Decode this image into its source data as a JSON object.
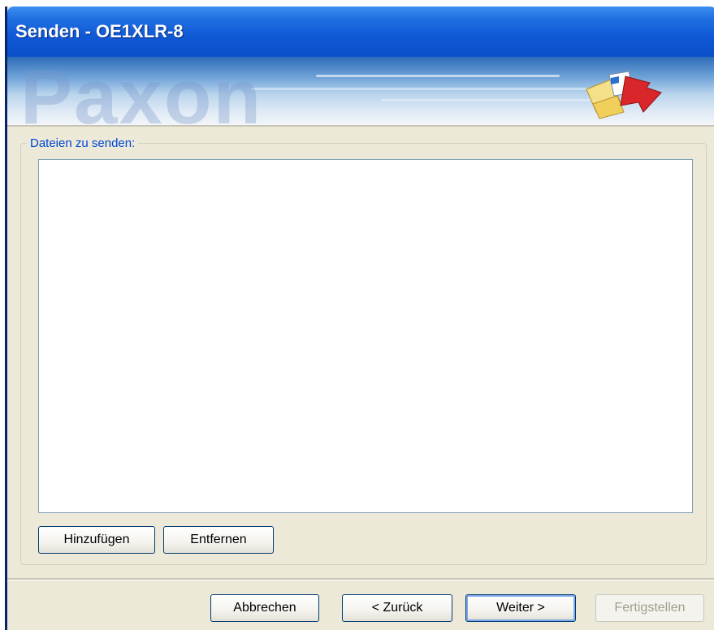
{
  "window": {
    "title": "Senden - OE1XLR-8"
  },
  "banner": {
    "logo_text": "Paxon"
  },
  "files_group": {
    "label": "Dateien zu senden:",
    "files": [],
    "add_label": "Hinzufügen",
    "remove_label": "Entfernen"
  },
  "footer": {
    "cancel_label": "Abbrechen",
    "back_label": "< Zurück",
    "next_label": "Weiter >",
    "finish_label": "Fertigstellen"
  },
  "colors": {
    "titlebar": "#1058d6",
    "dialog_bg": "#ece9d8",
    "group_label": "#0046d5",
    "disabled_text": "#a0a08c"
  },
  "icons": {
    "banner_icon": "file-transfer-icon"
  }
}
